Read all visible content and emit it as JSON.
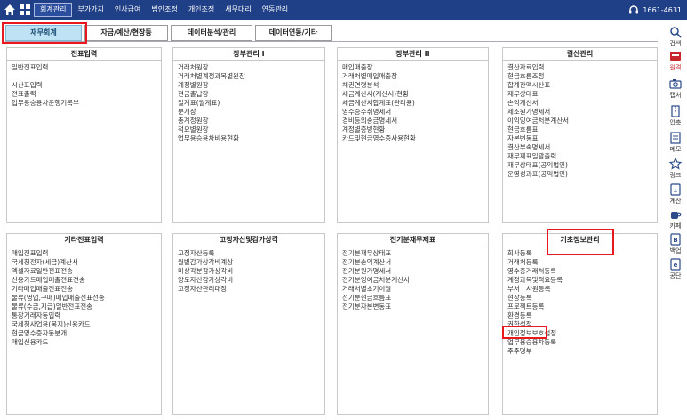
{
  "topbar": {
    "menu": [
      "회계관리",
      "부가가치",
      "인사급여",
      "법인조정",
      "개인조정",
      "세무대리",
      "연동관리"
    ],
    "phone": "1661-4631"
  },
  "subtabs": [
    "재무회계",
    "자금/예산/현장등",
    "데이터분석/관리",
    "데이터연동/기타"
  ],
  "sections": {
    "s1": {
      "title": "전표입력",
      "rows": [
        "일반전표입력",
        "",
        "시산표입력",
        "전표출력",
        "업무용승용차운행기록부"
      ]
    },
    "s2": {
      "title": "장부관리 I",
      "rows": [
        "거래처원장",
        "거래처별계정과목별원장",
        "계정별원장",
        "현금출납장",
        "일계표(월계표)",
        "분개장",
        "총계정원장",
        "적요별원장",
        "업무용승용차비용현황"
      ]
    },
    "s3": {
      "title": "장부관리 II",
      "rows": [
        "매입매출장",
        "거래처별매입매출장",
        "채권연령분석",
        "세금계산서(계산서)현황",
        "세금계산서합계표(관리용)",
        "영수증수취명세서",
        "경비등의송금명세서",
        "계정별증빙현황",
        "카드및현금영수증사용현황"
      ]
    },
    "s4": {
      "title": "결산관리",
      "rows": [
        "결산자료입력",
        "현금흐름조정",
        "합계잔액시산표",
        "재무상태표",
        "손익계산서",
        "제조원가명세서",
        "이익잉여금처분계산서",
        "현금흐름표",
        "자본변동표",
        "결산부속명세서",
        "재무제표일괄출력",
        "재무상태표(공익법인)",
        "운영성과표(공익법인)"
      ]
    },
    "s5": {
      "title": "기타전표입력",
      "rows": [
        "매입전표입력",
        "국세청전자(세금)계산서",
        "엑셀자료일반전표전송",
        "신용카드매입매출전표전송",
        "기타매입매출전표전송",
        "물류(영업,구매)매입매출전표전송",
        "물류(수금,지급)일반전표전송",
        "통장거래자동입력",
        "국세청사업용(복지)신용카드",
        "현금영수증자동분개",
        "매입신용카드"
      ]
    },
    "s6": {
      "title": "고정자산및감가상각",
      "rows": [
        "고정자산등록",
        "월별감가상각비계상",
        "미상각분감가상각비",
        "양도자산감가상각비",
        "고정자산관리대장"
      ]
    },
    "s7": {
      "title": "전기분재무제표",
      "rows": [
        "전기분재무상태표",
        "전기분손익계산서",
        "전기분원가명세서",
        "전기분잉여금처분계산서",
        "거래처별초기이월",
        "전기분현금흐름표",
        "전기분자본변동표"
      ]
    },
    "s8": {
      "title": "기초정보관리",
      "rows": [
        "회사등록",
        "거래처등록",
        "영수증거래처등록",
        "계정과목및적요등록",
        "부서 · 사원등록",
        "현장등록",
        "프로젝트등록",
        "환경등록",
        "권한설정",
        "개인정보보호설정",
        "업무용승용차등록",
        "주주명부"
      ]
    }
  },
  "sidebar": [
    "검색",
    "원격",
    "캡처",
    "압축",
    "메모",
    "링크",
    "계산",
    "카페",
    "백업",
    "공단"
  ]
}
